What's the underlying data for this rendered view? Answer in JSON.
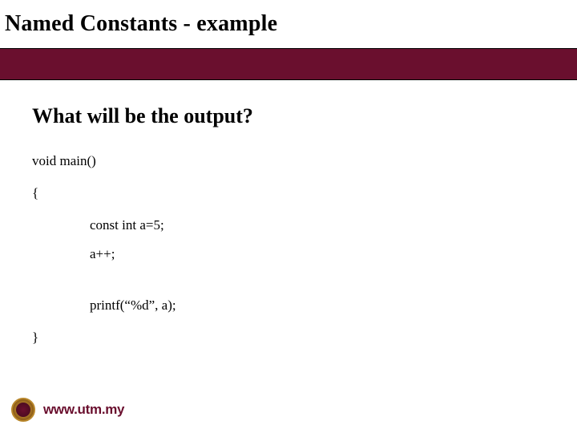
{
  "title": "Named Constants - example",
  "subheading": "What will be the output?",
  "code": {
    "line1": "void main()",
    "line2": "{",
    "line3": "const int a=5;",
    "line4": "a++;",
    "line5": "printf(“%d”, a);",
    "line6": "}"
  },
  "footer": {
    "url": "www.utm.my"
  },
  "colors": {
    "brand": "#6a0f2e",
    "gold": "#b8862a"
  }
}
